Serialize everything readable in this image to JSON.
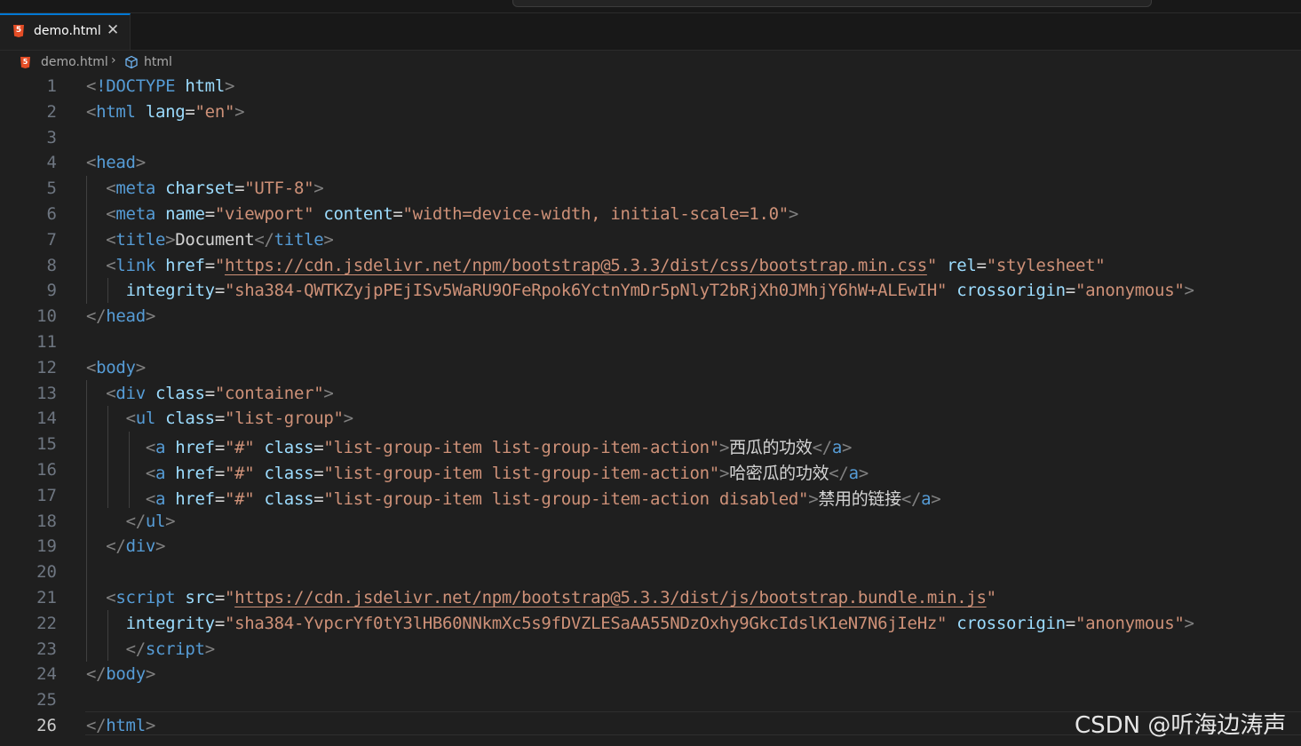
{
  "tab": {
    "filename": "demo.html",
    "icon": "html5-icon",
    "close_glyph": "✕"
  },
  "breadcrumb": {
    "file": "demo.html",
    "separator": "›",
    "element": "html"
  },
  "editor": {
    "active_line": 26,
    "lines": [
      {
        "n": 1,
        "tokens": [
          [
            "b",
            "<"
          ],
          [
            "tag",
            "!DOCTYPE"
          ],
          [
            "txt",
            " "
          ],
          [
            "attr",
            "html"
          ],
          [
            "b",
            ">"
          ]
        ]
      },
      {
        "n": 2,
        "tokens": [
          [
            "b",
            "<"
          ],
          [
            "tag",
            "html"
          ],
          [
            "txt",
            " "
          ],
          [
            "attr",
            "lang"
          ],
          [
            "txt",
            "="
          ],
          [
            "str",
            "\"en\""
          ],
          [
            "b",
            ">"
          ]
        ]
      },
      {
        "n": 3,
        "tokens": []
      },
      {
        "n": 4,
        "tokens": [
          [
            "b",
            "<"
          ],
          [
            "tag",
            "head"
          ],
          [
            "b",
            ">"
          ]
        ]
      },
      {
        "n": 5,
        "tokens": [
          [
            "txt",
            "  "
          ],
          [
            "b",
            "<"
          ],
          [
            "tag",
            "meta"
          ],
          [
            "txt",
            " "
          ],
          [
            "attr",
            "charset"
          ],
          [
            "txt",
            "="
          ],
          [
            "str",
            "\"UTF-8\""
          ],
          [
            "b",
            ">"
          ]
        ]
      },
      {
        "n": 6,
        "tokens": [
          [
            "txt",
            "  "
          ],
          [
            "b",
            "<"
          ],
          [
            "tag",
            "meta"
          ],
          [
            "txt",
            " "
          ],
          [
            "attr",
            "name"
          ],
          [
            "txt",
            "="
          ],
          [
            "str",
            "\"viewport\""
          ],
          [
            "txt",
            " "
          ],
          [
            "attr",
            "content"
          ],
          [
            "txt",
            "="
          ],
          [
            "str",
            "\"width=device-width, initial-scale=1.0\""
          ],
          [
            "b",
            ">"
          ]
        ]
      },
      {
        "n": 7,
        "tokens": [
          [
            "txt",
            "  "
          ],
          [
            "b",
            "<"
          ],
          [
            "tag",
            "title"
          ],
          [
            "b",
            ">"
          ],
          [
            "txt",
            "Document"
          ],
          [
            "b",
            "</"
          ],
          [
            "tag",
            "title"
          ],
          [
            "b",
            ">"
          ]
        ]
      },
      {
        "n": 8,
        "tokens": [
          [
            "txt",
            "  "
          ],
          [
            "b",
            "<"
          ],
          [
            "tag",
            "link"
          ],
          [
            "txt",
            " "
          ],
          [
            "attr",
            "href"
          ],
          [
            "txt",
            "="
          ],
          [
            "str",
            "\""
          ],
          [
            "link",
            "https://cdn.jsdelivr.net/npm/bootstrap@5.3.3/dist/css/bootstrap.min.css"
          ],
          [
            "str",
            "\""
          ],
          [
            "txt",
            " "
          ],
          [
            "attr",
            "rel"
          ],
          [
            "txt",
            "="
          ],
          [
            "str",
            "\"stylesheet\""
          ]
        ]
      },
      {
        "n": 9,
        "tokens": [
          [
            "txt",
            "    "
          ],
          [
            "attr",
            "integrity"
          ],
          [
            "txt",
            "="
          ],
          [
            "str",
            "\"sha384-QWTKZyjpPEjISv5WaRU9OFeRpok6YctnYmDr5pNlyT2bRjXh0JMhjY6hW+ALEwIH\""
          ],
          [
            "txt",
            " "
          ],
          [
            "attr",
            "crossorigin"
          ],
          [
            "txt",
            "="
          ],
          [
            "str",
            "\"anonymous\""
          ],
          [
            "b",
            ">"
          ]
        ]
      },
      {
        "n": 10,
        "tokens": [
          [
            "b",
            "</"
          ],
          [
            "tag",
            "head"
          ],
          [
            "b",
            ">"
          ]
        ]
      },
      {
        "n": 11,
        "tokens": []
      },
      {
        "n": 12,
        "tokens": [
          [
            "b",
            "<"
          ],
          [
            "tag",
            "body"
          ],
          [
            "b",
            ">"
          ]
        ]
      },
      {
        "n": 13,
        "tokens": [
          [
            "txt",
            "  "
          ],
          [
            "b",
            "<"
          ],
          [
            "tag",
            "div"
          ],
          [
            "txt",
            " "
          ],
          [
            "attr",
            "class"
          ],
          [
            "txt",
            "="
          ],
          [
            "str",
            "\"container\""
          ],
          [
            "b",
            ">"
          ]
        ]
      },
      {
        "n": 14,
        "tokens": [
          [
            "txt",
            "    "
          ],
          [
            "b",
            "<"
          ],
          [
            "tag",
            "ul"
          ],
          [
            "txt",
            " "
          ],
          [
            "attr",
            "class"
          ],
          [
            "txt",
            "="
          ],
          [
            "str",
            "\"list-group\""
          ],
          [
            "b",
            ">"
          ]
        ]
      },
      {
        "n": 15,
        "tokens": [
          [
            "txt",
            "      "
          ],
          [
            "b",
            "<"
          ],
          [
            "tag",
            "a"
          ],
          [
            "txt",
            " "
          ],
          [
            "attr",
            "href"
          ],
          [
            "txt",
            "="
          ],
          [
            "str",
            "\"#\""
          ],
          [
            "txt",
            " "
          ],
          [
            "attr",
            "class"
          ],
          [
            "txt",
            "="
          ],
          [
            "str",
            "\"list-group-item list-group-item-action\""
          ],
          [
            "b",
            ">"
          ],
          [
            "cjk",
            "西瓜的功效"
          ],
          [
            "b",
            "</"
          ],
          [
            "tag",
            "a"
          ],
          [
            "b",
            ">"
          ]
        ]
      },
      {
        "n": 16,
        "tokens": [
          [
            "txt",
            "      "
          ],
          [
            "b",
            "<"
          ],
          [
            "tag",
            "a"
          ],
          [
            "txt",
            " "
          ],
          [
            "attr",
            "href"
          ],
          [
            "txt",
            "="
          ],
          [
            "str",
            "\"#\""
          ],
          [
            "txt",
            " "
          ],
          [
            "attr",
            "class"
          ],
          [
            "txt",
            "="
          ],
          [
            "str",
            "\"list-group-item list-group-item-action\""
          ],
          [
            "b",
            ">"
          ],
          [
            "cjk",
            "哈密瓜的功效"
          ],
          [
            "b",
            "</"
          ],
          [
            "tag",
            "a"
          ],
          [
            "b",
            ">"
          ]
        ]
      },
      {
        "n": 17,
        "tokens": [
          [
            "txt",
            "      "
          ],
          [
            "b",
            "<"
          ],
          [
            "tag",
            "a"
          ],
          [
            "txt",
            " "
          ],
          [
            "attr",
            "href"
          ],
          [
            "txt",
            "="
          ],
          [
            "str",
            "\"#\""
          ],
          [
            "txt",
            " "
          ],
          [
            "attr",
            "class"
          ],
          [
            "txt",
            "="
          ],
          [
            "str",
            "\"list-group-item list-group-item-action disabled\""
          ],
          [
            "b",
            ">"
          ],
          [
            "cjk",
            "禁用的链接"
          ],
          [
            "b",
            "</"
          ],
          [
            "tag",
            "a"
          ],
          [
            "b",
            ">"
          ]
        ]
      },
      {
        "n": 18,
        "tokens": [
          [
            "txt",
            "    "
          ],
          [
            "b",
            "</"
          ],
          [
            "tag",
            "ul"
          ],
          [
            "b",
            ">"
          ]
        ]
      },
      {
        "n": 19,
        "tokens": [
          [
            "txt",
            "  "
          ],
          [
            "b",
            "</"
          ],
          [
            "tag",
            "div"
          ],
          [
            "b",
            ">"
          ]
        ]
      },
      {
        "n": 20,
        "tokens": []
      },
      {
        "n": 21,
        "tokens": [
          [
            "txt",
            "  "
          ],
          [
            "b",
            "<"
          ],
          [
            "tag",
            "script"
          ],
          [
            "txt",
            " "
          ],
          [
            "attr",
            "src"
          ],
          [
            "txt",
            "="
          ],
          [
            "str",
            "\""
          ],
          [
            "link",
            "https://cdn.jsdelivr.net/npm/bootstrap@5.3.3/dist/js/bootstrap.bundle.min.js"
          ],
          [
            "str",
            "\""
          ]
        ]
      },
      {
        "n": 22,
        "tokens": [
          [
            "txt",
            "    "
          ],
          [
            "attr",
            "integrity"
          ],
          [
            "txt",
            "="
          ],
          [
            "str",
            "\"sha384-YvpcrYf0tY3lHB60NNkmXc5s9fDVZLESaAA55NDzOxhy9GkcIdslK1eN7N6jIeHz\""
          ],
          [
            "txt",
            " "
          ],
          [
            "attr",
            "crossorigin"
          ],
          [
            "txt",
            "="
          ],
          [
            "str",
            "\"anonymous\""
          ],
          [
            "b",
            ">"
          ]
        ]
      },
      {
        "n": 23,
        "tokens": [
          [
            "txt",
            "    "
          ],
          [
            "b",
            "</"
          ],
          [
            "tag",
            "script"
          ],
          [
            "b",
            ">"
          ]
        ]
      },
      {
        "n": 24,
        "tokens": [
          [
            "b",
            "</"
          ],
          [
            "tag",
            "body"
          ],
          [
            "b",
            ">"
          ]
        ]
      },
      {
        "n": 25,
        "tokens": []
      },
      {
        "n": 26,
        "tokens": [
          [
            "b",
            "</"
          ],
          [
            "tag",
            "html"
          ],
          [
            "b",
            ">"
          ]
        ]
      }
    ]
  },
  "watermark": "CSDN @听海边涛声",
  "colors": {
    "background": "#1f1f1f",
    "tag": "#569cd6",
    "attribute": "#9cdcfe",
    "string": "#ce9178",
    "bracket": "#808080",
    "accent": "#0078d4",
    "html5_icon": "#e44d26"
  }
}
